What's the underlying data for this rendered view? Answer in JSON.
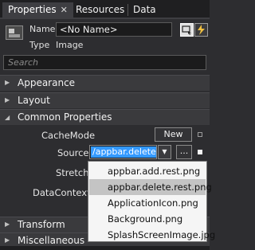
{
  "tabs": [
    {
      "label": "Properties",
      "close": "✕"
    },
    {
      "label": "Resources"
    },
    {
      "label": "Data"
    }
  ],
  "header": {
    "name_label": "Name",
    "name_value": "<No Name>",
    "type_label": "Type",
    "type_value": "Image"
  },
  "search": {
    "placeholder": "Search"
  },
  "categories": {
    "appearance": "Appearance",
    "layout": "Layout",
    "common": "Common Properties",
    "transform": "Transform",
    "misc": "Miscellaneous"
  },
  "props": {
    "cachemode_label": "CacheMode",
    "new_button": "New",
    "source_label": "Source",
    "source_value": "/appbar.delete.r",
    "dots_button": "...",
    "stretch_label": "Stretch",
    "datacontext_label": "DataContext"
  },
  "dropdown": [
    "appbar.add.rest.png",
    "appbar.delete.rest.png",
    "ApplicationIcon.png",
    "Background.png",
    "SplashScreenImage.jpg"
  ],
  "icons": {
    "expand": "▶",
    "collapse": "◢",
    "dropdown_arrow": "▼"
  }
}
